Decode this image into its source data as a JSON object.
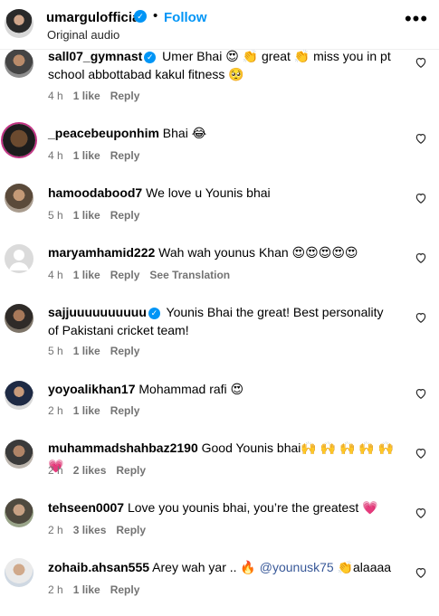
{
  "header": {
    "username": "umargulofficial",
    "follow_label": "Follow",
    "audio": "Original audio",
    "more": "•••"
  },
  "comments": [
    {
      "user": "sall07_gymnast",
      "text": " Umer Bhai 😍 👏 great 👏 miss you in pt school abbottabad kakul fitness 🥺",
      "time": "4 h",
      "likes": "1 like",
      "reply": "Reply"
    },
    {
      "user": "_peacebeuponhim",
      "text": " Bhai 😂",
      "time": "4 h",
      "likes": "1 like",
      "reply": "Reply"
    },
    {
      "user": "hamoodabood7",
      "text": " We love u Younis bhai",
      "time": "5 h",
      "likes": "1 like",
      "reply": "Reply"
    },
    {
      "user": "maryamhamid222",
      "text": " Wah wah younus Khan 😍😍😍😍😍",
      "time": "4 h",
      "likes": "1 like",
      "reply": "Reply",
      "extra": "See Translation"
    },
    {
      "user": "sajjuuuuuuuuuu",
      "text": " Younis Bhai the great! Best personality of Pakistani cricket team!",
      "time": "5 h",
      "likes": "1 like",
      "reply": "Reply"
    },
    {
      "user": "yoyoalikhan17",
      "text": " Mohammad rafi 😍",
      "time": "2 h",
      "likes": "1 like",
      "reply": "Reply"
    },
    {
      "user": "muhammadshahbaz2190",
      "text": " Good Younis bhai🙌 🙌 🙌 🙌 🙌 💗",
      "time": "2 h",
      "likes": "2 likes",
      "reply": "Reply"
    },
    {
      "user": "tehseen0007",
      "text": " Love you younis bhai, you’re the greatest 💗",
      "time": "2 h",
      "likes": "3 likes",
      "reply": "Reply"
    },
    {
      "user": "zohaib.ahsan555",
      "text_before": " Arey wah yar .. 🔥 ",
      "mention": "@younusk75",
      "text_after": " 👏alaaaa",
      "time": "2 h",
      "likes": "1 like",
      "reply": "Reply"
    }
  ],
  "colors": {
    "accent": "#0095f6",
    "meta_text": "#737373",
    "mention": "#385898"
  }
}
